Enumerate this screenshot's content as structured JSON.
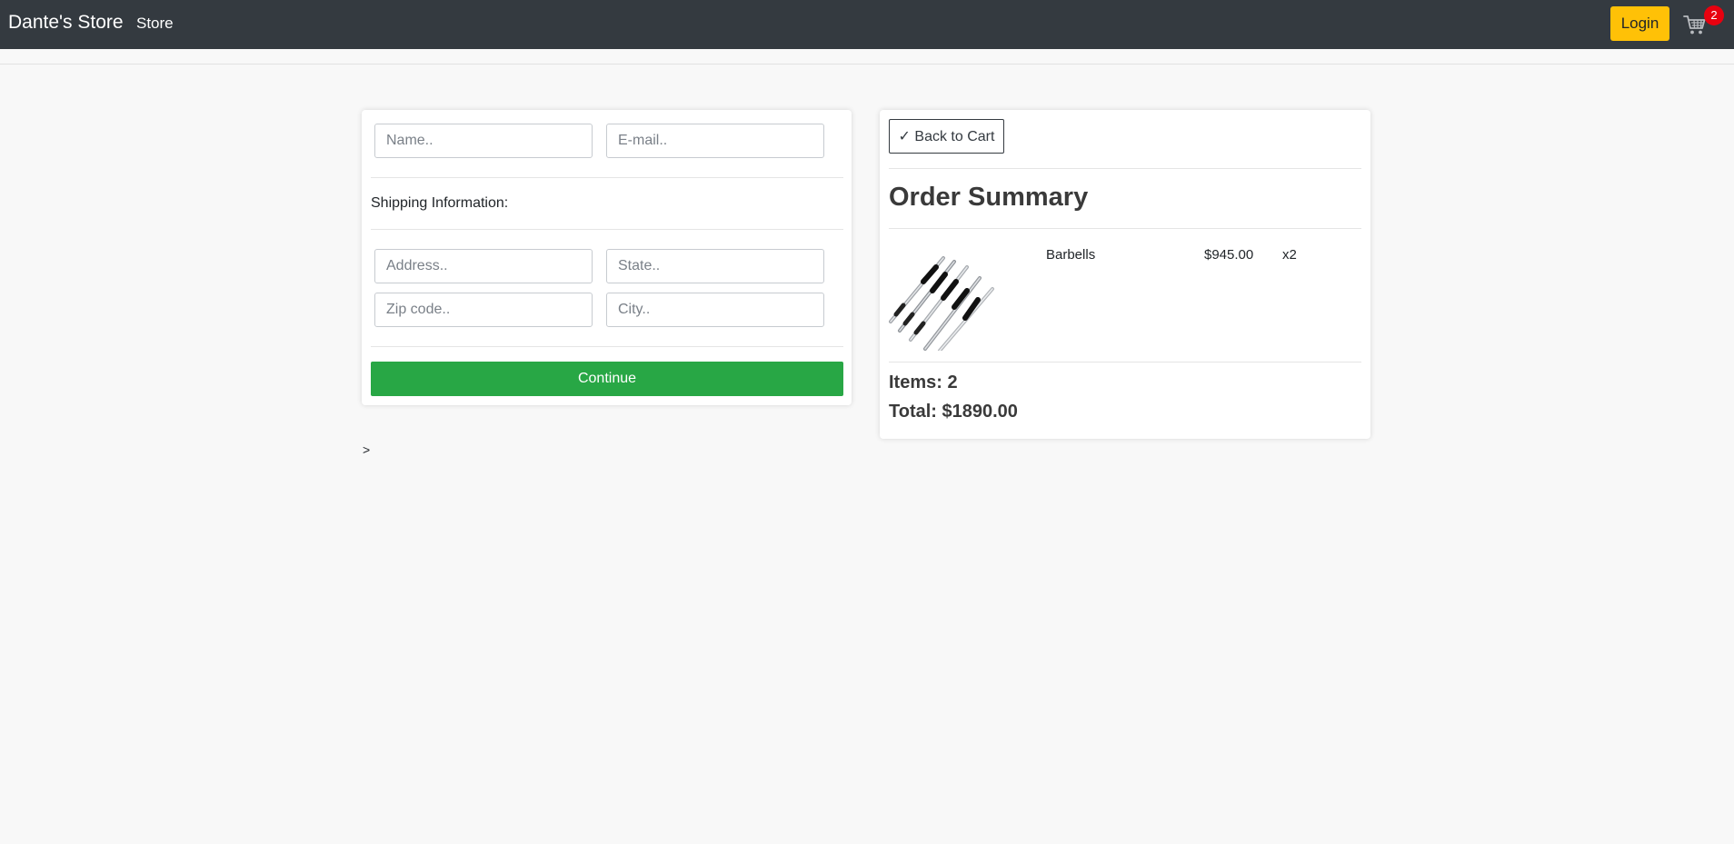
{
  "navbar": {
    "brand": "Dante's Store",
    "store_link": "Store",
    "login_label": "Login",
    "cart_count": "2",
    "cart_icon": "cart-icon"
  },
  "form": {
    "name_placeholder": "Name..",
    "email_placeholder": "E-mail..",
    "shipping_label": "Shipping Information:",
    "address_placeholder": "Address..",
    "state_placeholder": "State..",
    "zip_placeholder": "Zip code..",
    "city_placeholder": "City..",
    "continue_label": "Continue"
  },
  "summary": {
    "back_label": "✓ Back to Cart",
    "title": "Order Summary",
    "items": [
      {
        "name": "Barbells",
        "price": "$945.00",
        "qty": "x2",
        "image_icon": "barbells-image"
      }
    ],
    "items_count": "Items: 2",
    "total": "Total: $1890.00"
  },
  "stray_text": ">",
  "colors": {
    "navbar_bg": "#343a40",
    "login_bg": "#ffc107",
    "continue_bg": "#28a745",
    "badge_bg": "#e8010f",
    "page_bg": "#f8f8f8"
  }
}
